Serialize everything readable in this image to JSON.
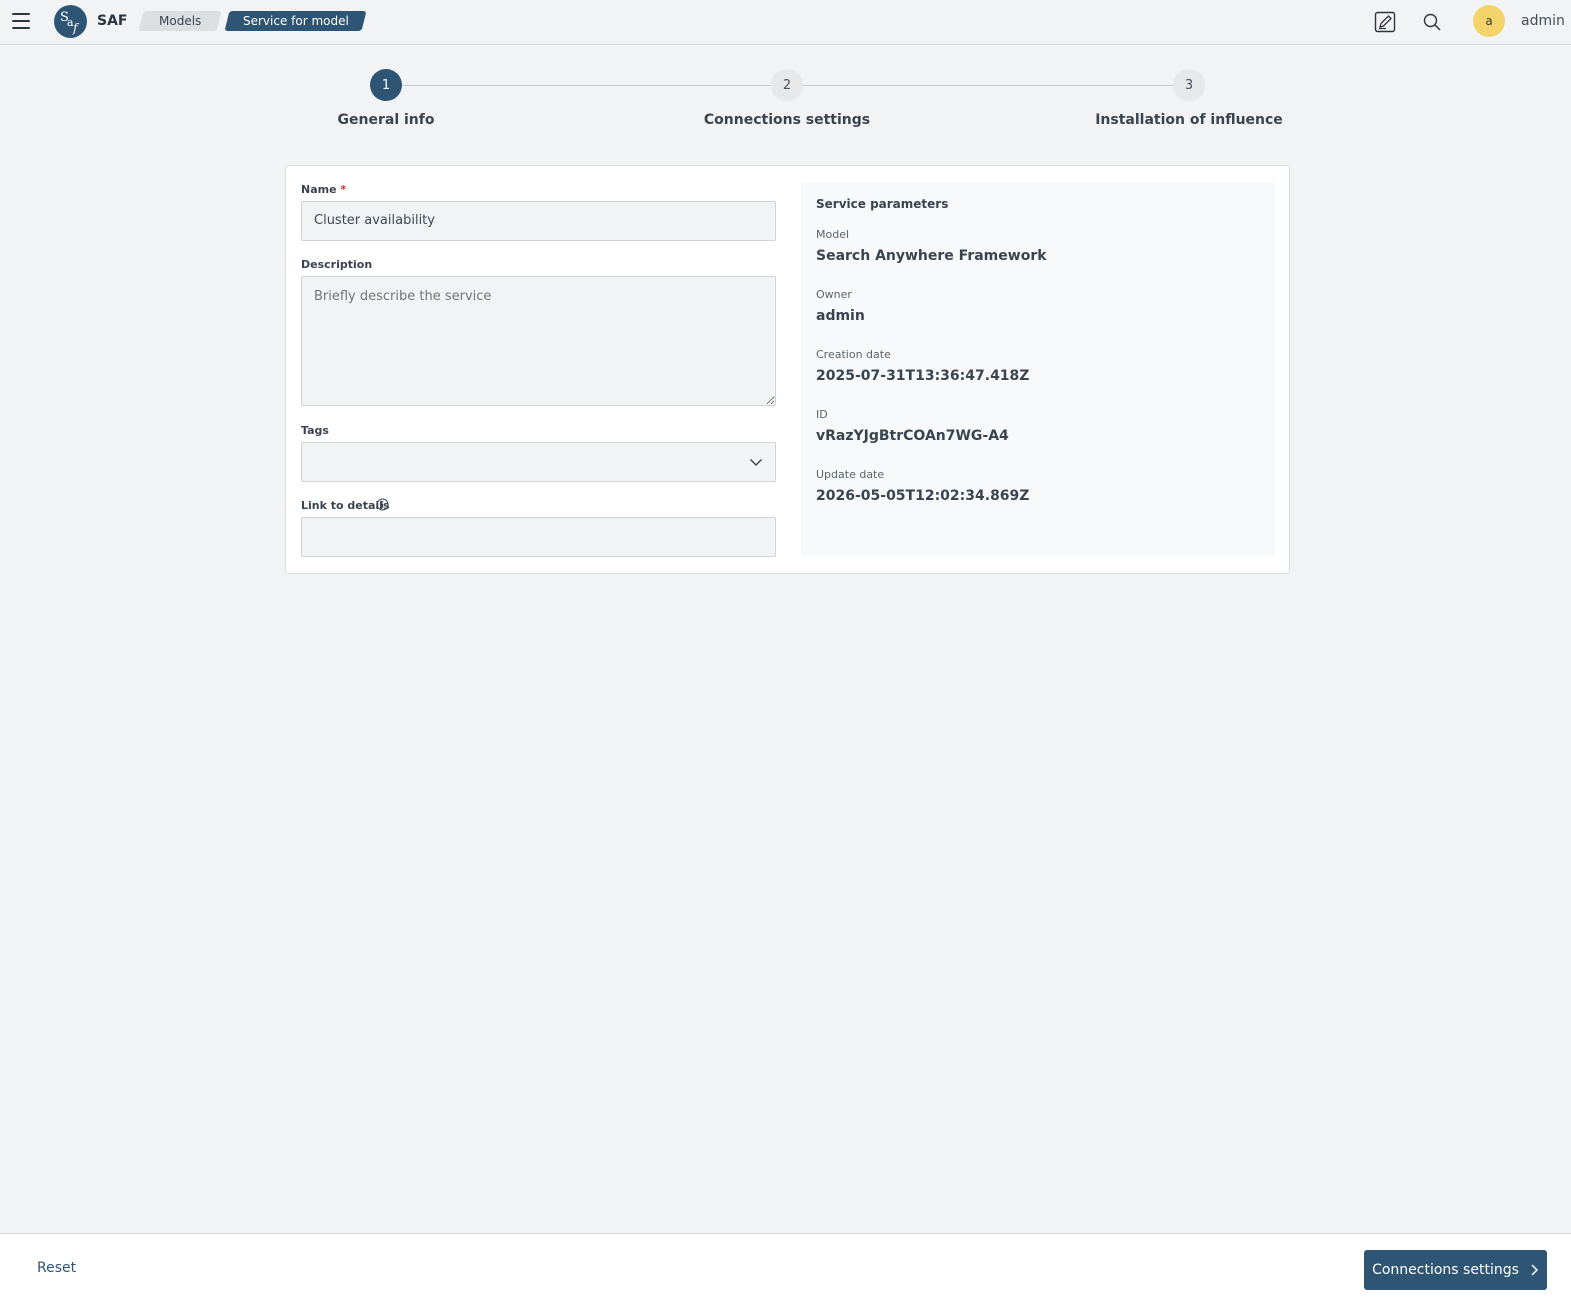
{
  "app": {
    "name": "SAF",
    "logo_text": "Saf"
  },
  "breadcrumbs": [
    "Models",
    "Service for model"
  ],
  "user": {
    "avatar_letter": "a",
    "name": "admin"
  },
  "icons": {
    "menu": "hamburger-icon",
    "edit": "edit-square-icon",
    "search": "search-icon",
    "tags_dropdown": "chevron-down-icon",
    "link_info": "info-icon",
    "next": "chevron-right-icon"
  },
  "colors": {
    "accent": "#2e5573",
    "avatar": "#f4d46a",
    "background": "#f2f3f4",
    "required": "#c0392b"
  },
  "steps": [
    {
      "number": "1",
      "label": "General info",
      "active": true
    },
    {
      "number": "2",
      "label": "Connections settings",
      "active": false
    },
    {
      "number": "3",
      "label": "Installation of influence",
      "active": false
    }
  ],
  "form": {
    "name": {
      "label": "Name",
      "required_mark": "*",
      "value": "Cluster availability"
    },
    "description": {
      "label": "Description",
      "placeholder": "Briefly describe the service",
      "value": ""
    },
    "tags": {
      "label": "Tags",
      "value": ""
    },
    "link": {
      "label": "Link to details",
      "value": ""
    }
  },
  "service_parameters": {
    "title": "Service parameters",
    "model": {
      "label": "Model",
      "value": "Search Anywhere Framework"
    },
    "owner": {
      "label": "Owner",
      "value": "admin"
    },
    "creation_date": {
      "label": "Creation date",
      "value": "2025-07-31T13:36:47.418Z"
    },
    "id": {
      "label": "ID",
      "value": "vRazYJgBtrCOAn7WG-A4"
    },
    "update_date": {
      "label": "Update date",
      "value": "2026-05-05T12:02:34.869Z"
    }
  },
  "footer": {
    "reset_label": "Reset",
    "next_label": "Connections settings"
  }
}
